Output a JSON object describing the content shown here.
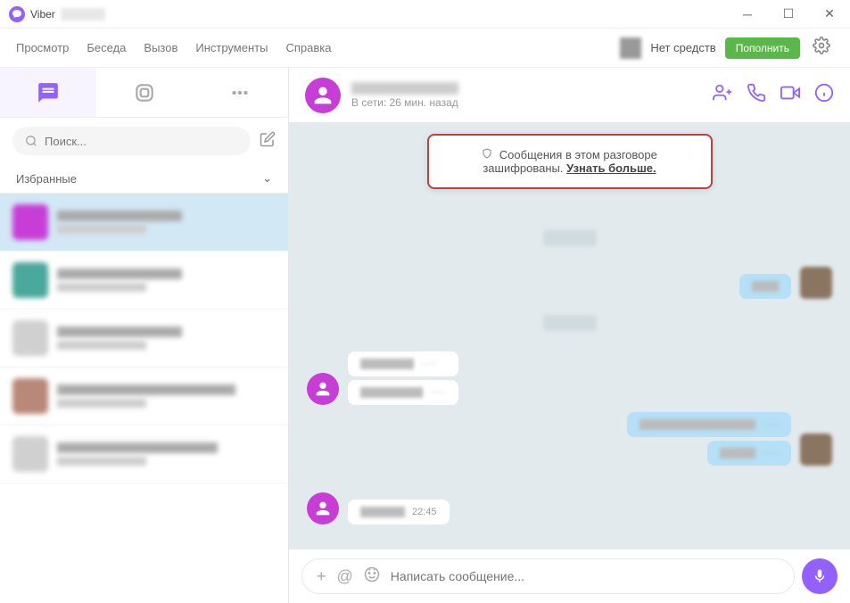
{
  "window": {
    "title": "Viber"
  },
  "menubar": {
    "items": [
      "Просмотр",
      "Беседа",
      "Вызов",
      "Инструменты",
      "Справка"
    ],
    "balance": "Нет средств",
    "topup": "Пополнить"
  },
  "sidebar": {
    "search_placeholder": "Поиск...",
    "favorites_label": "Избранные"
  },
  "conversation": {
    "status": "В сети: 26 мин. назад",
    "encryption_notice": "Сообщения в этом разговоре зашифрованы.",
    "encryption_link": "Узнать больше.",
    "last_time": "22:45"
  },
  "composer": {
    "placeholder": "Написать сообщение..."
  }
}
